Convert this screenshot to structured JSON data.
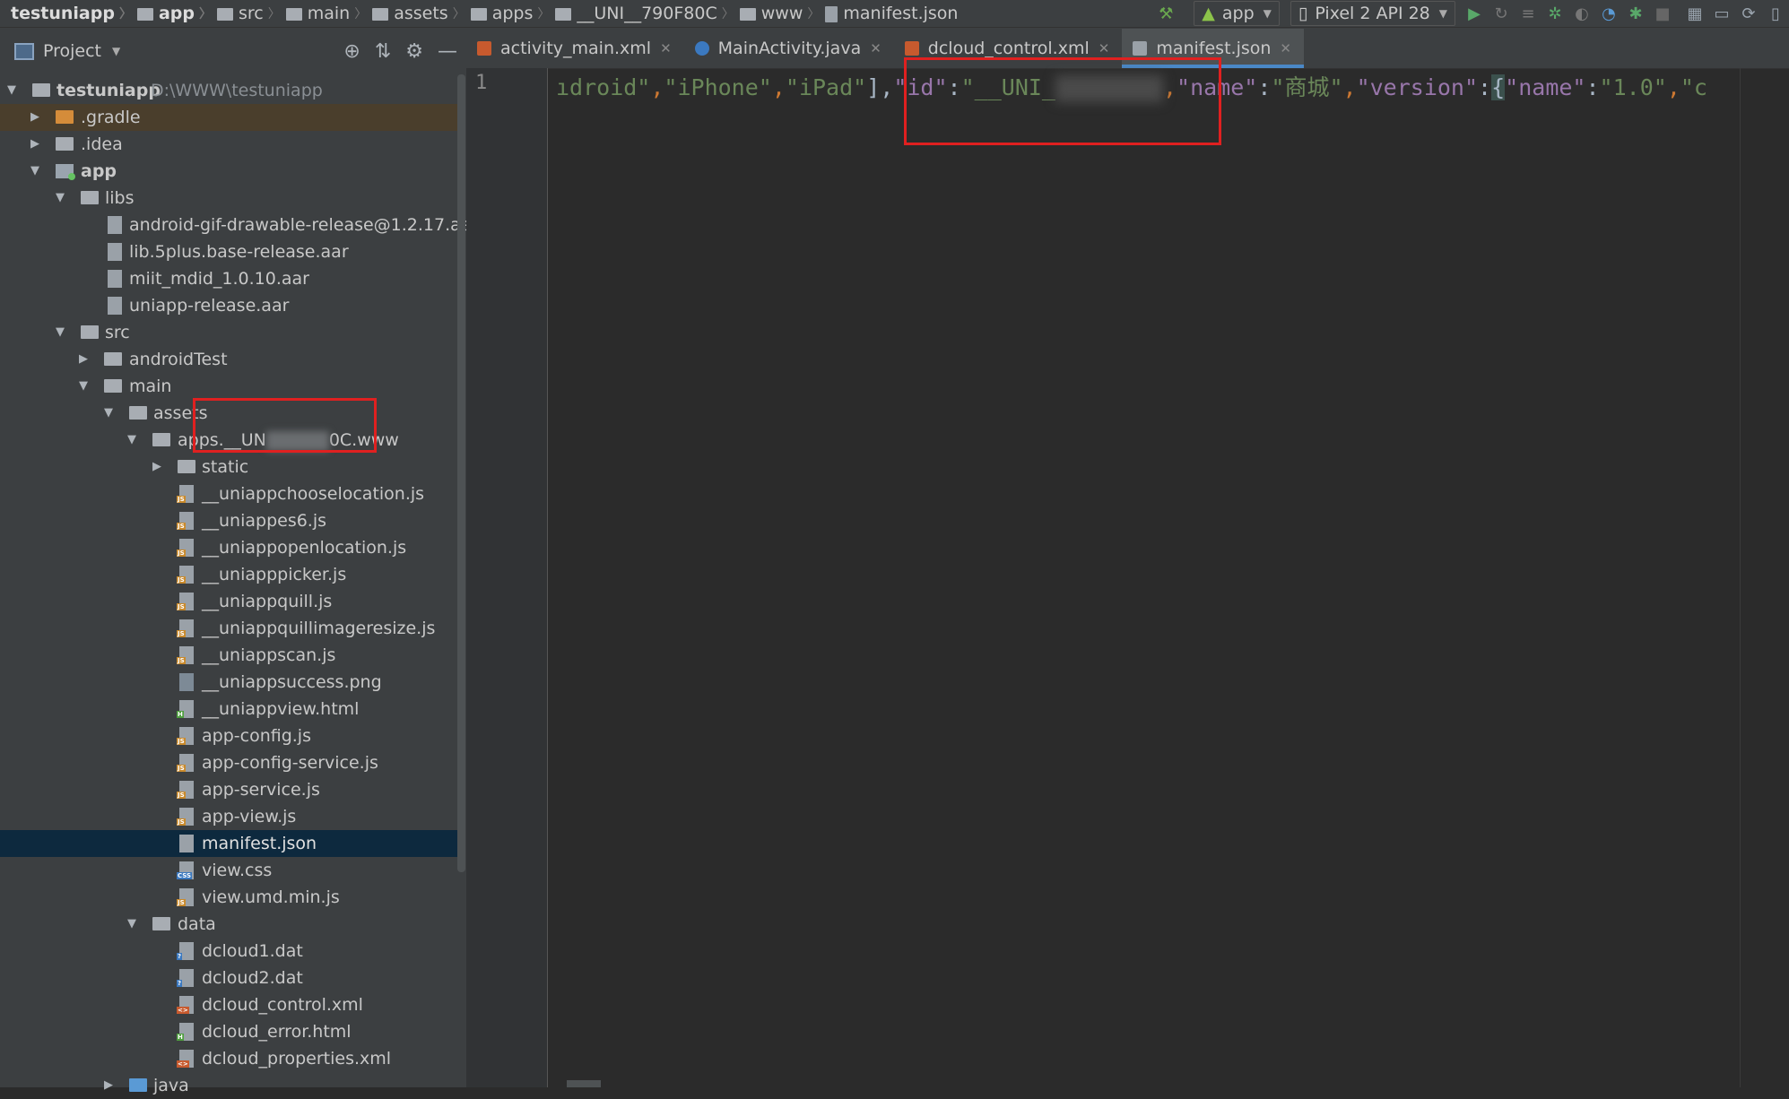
{
  "breadcrumbs": [
    "testuniapp",
    "app",
    "src",
    "main",
    "assets",
    "apps",
    "__UNI__790F80C",
    "www",
    "manifest.json"
  ],
  "toolbar": {
    "run_config": "app",
    "device": "Pixel 2 API 28"
  },
  "project_panel": {
    "title": "Project",
    "root_name": "testuniapp",
    "root_path": "D:\\WWW\\testuniapp",
    "tree": [
      {
        "label": "testuniapp",
        "depth": 0
      },
      {
        "label": ".gradle",
        "depth": 1
      },
      {
        "label": ".idea",
        "depth": 1
      },
      {
        "label": "app",
        "depth": 1
      },
      {
        "label": "libs",
        "depth": 2
      },
      {
        "label": "android-gif-drawable-release@1.2.17.aar",
        "depth": 3
      },
      {
        "label": "lib.5plus.base-release.aar",
        "depth": 3
      },
      {
        "label": "miit_mdid_1.0.10.aar",
        "depth": 3
      },
      {
        "label": "uniapp-release.aar",
        "depth": 3
      },
      {
        "label": "src",
        "depth": 2
      },
      {
        "label": "androidTest",
        "depth": 3
      },
      {
        "label": "main",
        "depth": 3
      },
      {
        "label": "assets",
        "depth": 4
      },
      {
        "label_a": "apps.__UN",
        "label_b": "0C.www",
        "depth": 5
      },
      {
        "label": "static",
        "depth": 6
      },
      {
        "label": "__uniappchooselocation.js",
        "depth": 6
      },
      {
        "label": "__uniappes6.js",
        "depth": 6
      },
      {
        "label": "__uniappopenlocation.js",
        "depth": 6
      },
      {
        "label": "__uniapppicker.js",
        "depth": 6
      },
      {
        "label": "__uniappquill.js",
        "depth": 6
      },
      {
        "label": "__uniappquillimageresize.js",
        "depth": 6
      },
      {
        "label": "__uniappscan.js",
        "depth": 6
      },
      {
        "label": "__uniappsuccess.png",
        "depth": 6
      },
      {
        "label": "__uniappview.html",
        "depth": 6
      },
      {
        "label": "app-config.js",
        "depth": 6
      },
      {
        "label": "app-config-service.js",
        "depth": 6
      },
      {
        "label": "app-service.js",
        "depth": 6
      },
      {
        "label": "app-view.js",
        "depth": 6
      },
      {
        "label": "manifest.json",
        "depth": 6
      },
      {
        "label": "view.css",
        "depth": 6
      },
      {
        "label": "view.umd.min.js",
        "depth": 6
      },
      {
        "label": "data",
        "depth": 5
      },
      {
        "label": "dcloud1.dat",
        "depth": 6
      },
      {
        "label": "dcloud2.dat",
        "depth": 6
      },
      {
        "label": "dcloud_control.xml",
        "depth": 6
      },
      {
        "label": "dcloud_error.html",
        "depth": 6
      },
      {
        "label": "dcloud_properties.xml",
        "depth": 6
      },
      {
        "label": "java",
        "depth": 4
      }
    ]
  },
  "tabs": [
    {
      "label": "activity_main.xml"
    },
    {
      "label": "MainActivity.java"
    },
    {
      "label": "dcloud_control.xml"
    },
    {
      "label": "manifest.json"
    }
  ],
  "editor": {
    "line_number": "1",
    "tokens": {
      "t1": "ıdroid\"",
      "t2": ",",
      "t3": "\"iPhone\"",
      "t4": ",",
      "t5": "\"iPad\"",
      "t6": "],",
      "t7": "\"id\"",
      "t8": ":",
      "t9": "\"__UNI_",
      "t10": ",",
      "t11": "\"name\"",
      "t12": ":",
      "t13": "\"商城\"",
      "t14": ",",
      "t15": "\"version\"",
      "t16": ":",
      "t17": "{",
      "t18": "\"name\"",
      "t19": ":",
      "t20": "\"1.0\"",
      "t21": ",",
      "t22": "\"c"
    }
  },
  "colors": {
    "annotation_box": "#e02020",
    "selection": "#0d293e",
    "accent_tab": "#4a88c7"
  }
}
